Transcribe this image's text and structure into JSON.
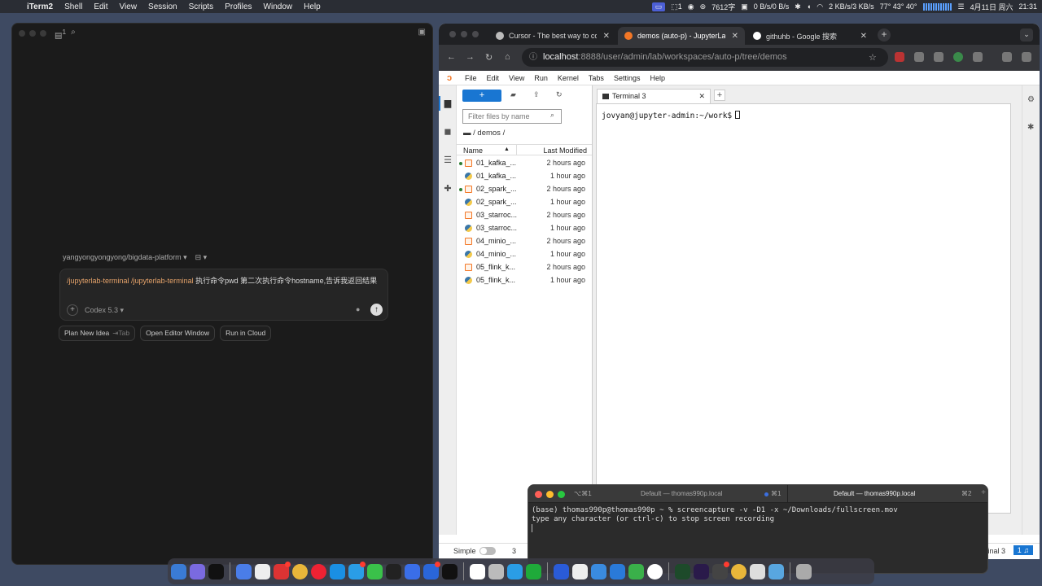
{
  "menubar": {
    "app_name": "iTerm2",
    "menus": [
      "Shell",
      "Edit",
      "View",
      "Session",
      "Scripts",
      "Profiles",
      "Window",
      "Help"
    ],
    "status": {
      "workspace": "1",
      "char_count": "7612字",
      "net_top": "0 B/s",
      "net_bottom": "0 B/s",
      "disk_top": "2 KB/s",
      "disk_bottom": "3 KB/s",
      "temps": "77° 43° 40°",
      "date": "4月11日 周六",
      "time": "21:31"
    }
  },
  "codex": {
    "repo_label": "yangyongyongyong/bigdata-platform",
    "prompt_cmd1": "/jupyterlab-terminal",
    "prompt_cmd2": "/jupyterlab-terminal",
    "prompt_text": "执行命令pwd 第二次执行命令hostname,告诉我返回结果",
    "plus_symbol": "+",
    "model": "Codex 5.3",
    "send_symbol": "↑",
    "actions": {
      "plan": "Plan New Idea",
      "plan_hint": "Tab",
      "editor": "Open Editor Window",
      "cloud": "Run in Cloud"
    },
    "badge_count": "1"
  },
  "browser": {
    "tabs": [
      {
        "title": "Cursor - The best way to code"
      },
      {
        "title": "demos (auto-p) - JupyterLab"
      },
      {
        "title": "githuhb - Google 搜索"
      }
    ],
    "close_symbol": "✕",
    "new_tab_symbol": "+",
    "url_host": "localhost",
    "url_path": ":8888/user/admin/lab/workspaces/auto-p/tree/demos"
  },
  "jupyter": {
    "menus": [
      "File",
      "Edit",
      "View",
      "Run",
      "Kernel",
      "Tabs",
      "Settings",
      "Help"
    ],
    "new_button": "+",
    "filter_placeholder": "Filter files by name",
    "breadcrumb": "/ demos /",
    "col_name": "Name",
    "col_modified": "Last Modified",
    "files": [
      {
        "name": "01_kafka_...",
        "modified": "2 hours ago",
        "type": "notebook",
        "running": true
      },
      {
        "name": "01_kafka_...",
        "modified": "1 hour ago",
        "type": "python",
        "running": false
      },
      {
        "name": "02_spark_...",
        "modified": "2 hours ago",
        "type": "notebook",
        "running": true
      },
      {
        "name": "02_spark_...",
        "modified": "1 hour ago",
        "type": "python",
        "running": false
      },
      {
        "name": "03_starroc...",
        "modified": "2 hours ago",
        "type": "notebook",
        "running": false
      },
      {
        "name": "03_starroc...",
        "modified": "1 hour ago",
        "type": "python",
        "running": false
      },
      {
        "name": "04_minio_...",
        "modified": "2 hours ago",
        "type": "notebook",
        "running": false
      },
      {
        "name": "04_minio_...",
        "modified": "1 hour ago",
        "type": "python",
        "running": false
      },
      {
        "name": "05_flink_k...",
        "modified": "2 hours ago",
        "type": "notebook",
        "running": false
      },
      {
        "name": "05_flink_k...",
        "modified": "1 hour ago",
        "type": "python",
        "running": false
      }
    ],
    "terminal_tab": "Terminal 3",
    "terminal_prompt": "jovyan@jupyter-admin:~/work$",
    "status": {
      "simple": "Simple",
      "count_a": "3",
      "count_b": "2",
      "label": "Terminal 3",
      "notifications": "1"
    }
  },
  "iterm_overlay": {
    "tab1_key": "⌥⌘1",
    "tab1_title": "Default — thomas990p.local",
    "tab1_shortcut": "⌘1",
    "tab2_title": "Default — thomas990p.local",
    "tab2_shortcut": "⌘2",
    "line1": "(base) thomas990p@thomas990p ~ % screencapture -v -D1 -x ~/Downloads/fullscreen.mov",
    "line2": "type any character (or ctrl-c) to stop screen recording"
  },
  "colors": {
    "jupyter_blue": "#1976d2",
    "jupyter_orange": "#f37726",
    "kernel_running": "#2e7d32"
  }
}
